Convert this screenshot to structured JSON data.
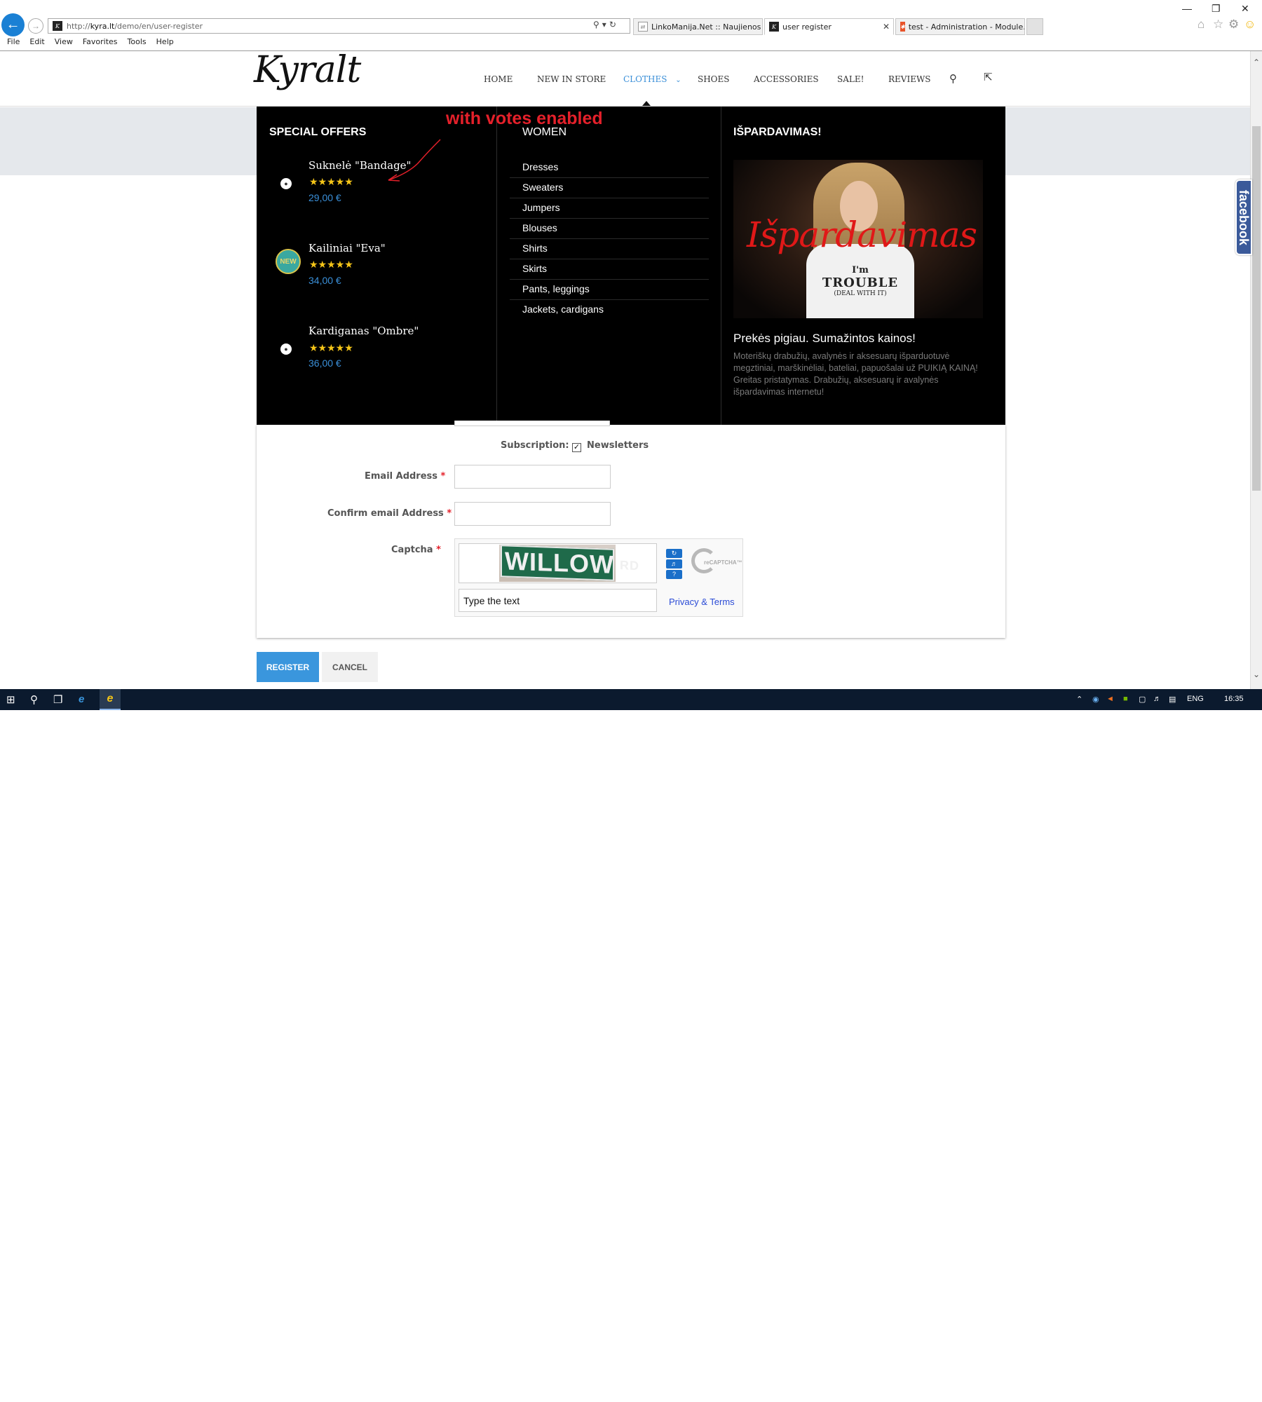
{
  "browser": {
    "url_prefix": "http://",
    "url_domain": "kyra.lt",
    "url_path": "/demo/en/user-register",
    "tabs": [
      {
        "title": "LinkoManija.Net :: Naujienos",
        "active": false
      },
      {
        "title": "user register",
        "active": true
      },
      {
        "title": "test - Administration - Module...",
        "active": false
      }
    ],
    "menu": [
      "File",
      "Edit",
      "View",
      "Favorites",
      "Tools",
      "Help"
    ]
  },
  "site": {
    "logo": "Kyralt",
    "nav": [
      {
        "label": "HOME",
        "active": false
      },
      {
        "label": "NEW IN STORE",
        "active": false
      },
      {
        "label": "CLOTHES",
        "active": true
      },
      {
        "label": "SHOES",
        "active": false
      },
      {
        "label": "ACCESSORIES",
        "active": false
      },
      {
        "label": "SALE!",
        "active": false
      },
      {
        "label": "REVIEWS",
        "active": false
      }
    ],
    "nav_dropdown_glyph": "⌄"
  },
  "mega_menu": {
    "special_offers": {
      "heading": "SPECIAL OFFERS",
      "items": [
        {
          "name": "Suknelė \"Bandage\"",
          "rating": 5,
          "stars": "★★★★★",
          "price": "29,00 €",
          "badge": ""
        },
        {
          "name": "Kailiniai \"Eva\"",
          "rating": 5,
          "stars": "★★★★★",
          "price": "34,00 €",
          "badge": "NEW"
        },
        {
          "name": "Kardiganas \"Ombre\"",
          "rating": 5,
          "stars": "★★★★★",
          "price": "36,00 €",
          "badge": ""
        }
      ]
    },
    "women": {
      "heading": "WOMEN",
      "categories": [
        "Dresses",
        "Sweaters",
        "Jumpers",
        "Blouses",
        "Shirts",
        "Skirts",
        "Pants, leggings",
        "Jackets, cardigans"
      ]
    },
    "promo": {
      "heading": "IŠPARDAVIMAS!",
      "image_overlay_text": "Išpardavimas",
      "image_shirt_line1": "I'm",
      "image_shirt_line2": "TROUBLE",
      "image_shirt_line3": "(DEAL WITH IT)",
      "title": "Prekės pigiau. Sumažintos kainos!",
      "description": "Moteriškų drabužių, avalynės ir aksesuarų išparduotuvė megztiniai, marškinėliai, bateliai, papuošalai už PUIKIĄ KAINĄ! Greitas pristatymas. Drabužių, aksesuarų ir avalynės išpardavimas internetu!"
    }
  },
  "annotation": "with votes enabled",
  "form": {
    "subscription_label": "Subscription:",
    "newsletter_label": "Newsletters",
    "newsletter_checked": true,
    "email_label": "Email Address",
    "confirm_email_label": "Confirm email Address",
    "captcha_label": "Captcha",
    "required_mark": "*",
    "captcha_image_text": "WILLOW",
    "captcha_image_suffix": "RD",
    "captcha_placeholder": "Type the text",
    "privacy_link": "Privacy & Terms",
    "recaptcha_brand": "reCAPTCHA™"
  },
  "buttons": {
    "register": "REGISTER",
    "cancel": "CANCEL"
  },
  "facebook_tab": "facebook",
  "taskbar": {
    "language": "ENG",
    "time": "16:35"
  },
  "colors": {
    "accent": "#3a96dd",
    "annotation": "#e4202a",
    "star": "#f5c518",
    "menu_bg": "#000000"
  }
}
